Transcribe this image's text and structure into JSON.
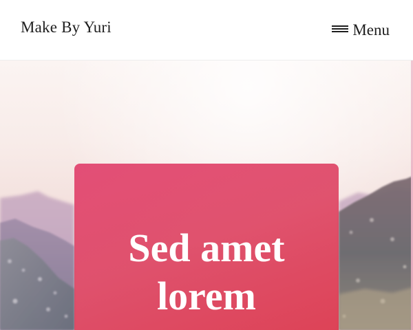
{
  "header": {
    "brand": "Make By Yuri",
    "menu_label": "Menu",
    "menu_icon": "hamburger-icon"
  },
  "hero": {
    "title": "Sed amet lorem",
    "background_image": "mountain-landscape",
    "card_color": "#e04a6e",
    "accent_colors": [
      "#e24872",
      "#dc3a4e",
      "#c24b8a"
    ]
  }
}
